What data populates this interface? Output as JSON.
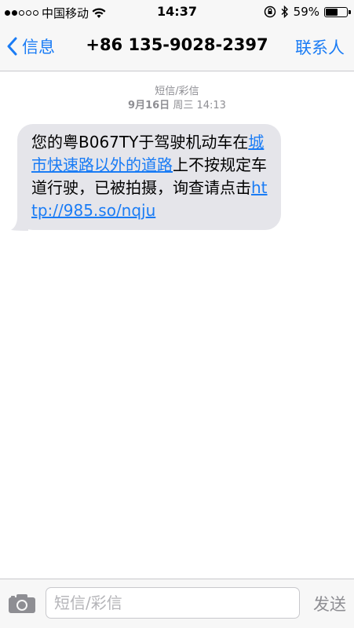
{
  "status_bar": {
    "carrier": "中国移动",
    "time": "14:37",
    "battery": "59%",
    "battery_level": 0.59,
    "signal_bars_filled": 2,
    "signal_bars_total": 5
  },
  "nav": {
    "back_label": "信息",
    "title": "+86 135-9028-2397",
    "contact_label": "联系人"
  },
  "meta": {
    "type_label": "短信/彩信",
    "date_prefix": "9月16日",
    "date_suffix": "周三 14:13"
  },
  "message": {
    "text_1": "您的粤B067TY于驾驶机动车在",
    "link_1": "城市快速路以外的道路",
    "text_2": "上不按规定车道行驶，已被拍摄，询查请点击",
    "link_2": "http://985.so/nqju"
  },
  "input_bar": {
    "placeholder": "短信/彩信",
    "send_label": "发送"
  },
  "colors": {
    "accent": "#1a7cf5",
    "bubble": "#e5e5ea"
  }
}
